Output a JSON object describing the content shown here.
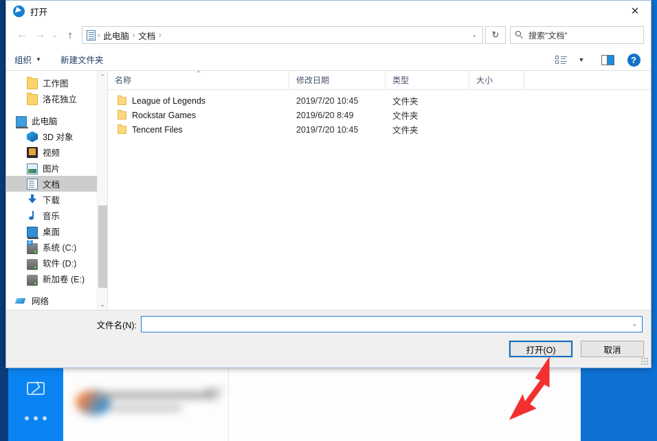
{
  "window": {
    "title": "打开",
    "title_icon": "cursor-circle-icon",
    "close_label": "✕"
  },
  "nav": {
    "back_icon": "←",
    "forward_icon": "→",
    "recent_icon": "⌄",
    "up_icon": "↑",
    "address_icon": "documents-icon",
    "breadcrumbs": [
      "此电脑",
      "文档"
    ],
    "separator": "›",
    "dropdown_caret": "⌄",
    "refresh_icon": "↻"
  },
  "search": {
    "placeholder": "搜索\"文档\"",
    "icon": "search-icon"
  },
  "command_bar": {
    "organize_label": "组织",
    "organize_caret": "▼",
    "new_folder_label": "新建文件夹",
    "view_icon": "list-view-icon",
    "view_caret": "▼",
    "preview_pane_icon": "preview-pane-icon",
    "help_icon": "?"
  },
  "sidebar": {
    "scroll_up": "⌃",
    "scroll_down": "⌄",
    "items": [
      {
        "label": "工作图",
        "icon": "folder-icon",
        "indent": 1,
        "selected": false
      },
      {
        "label": "洛花独立",
        "icon": "folder-icon",
        "indent": 1,
        "selected": false
      },
      {
        "label": "此电脑",
        "icon": "this-pc-icon",
        "indent": 0,
        "selected": false
      },
      {
        "label": "3D 对象",
        "icon": "3d-objects-icon",
        "indent": 1,
        "selected": false
      },
      {
        "label": "视频",
        "icon": "videos-icon",
        "indent": 1,
        "selected": false
      },
      {
        "label": "图片",
        "icon": "pictures-icon",
        "indent": 1,
        "selected": false
      },
      {
        "label": "文档",
        "icon": "documents-icon",
        "indent": 1,
        "selected": true
      },
      {
        "label": "下载",
        "icon": "downloads-icon",
        "indent": 1,
        "selected": false
      },
      {
        "label": "音乐",
        "icon": "music-icon",
        "indent": 1,
        "selected": false
      },
      {
        "label": "桌面",
        "icon": "desktop-icon",
        "indent": 1,
        "selected": false
      },
      {
        "label": "系统 (C:)",
        "icon": "system-drive-icon",
        "indent": 1,
        "selected": false
      },
      {
        "label": "软件 (D:)",
        "icon": "drive-icon",
        "indent": 1,
        "selected": false
      },
      {
        "label": "新加卷 (E:)",
        "icon": "drive-icon",
        "indent": 1,
        "selected": false
      },
      {
        "label": "网络",
        "icon": "network-icon",
        "indent": 0,
        "selected": false
      }
    ]
  },
  "file_list": {
    "columns": [
      "名称",
      "修改日期",
      "类型",
      "大小"
    ],
    "sort_caret": "⌃",
    "rows": [
      {
        "name": "League of Legends",
        "date": "2019/7/20 10:45",
        "type": "文件夹",
        "size": "",
        "icon": "folder-icon"
      },
      {
        "name": "Rockstar Games",
        "date": "2019/6/20 8:49",
        "type": "文件夹",
        "size": "",
        "icon": "folder-icon"
      },
      {
        "name": "Tencent Files",
        "date": "2019/7/20 10:45",
        "type": "文件夹",
        "size": "",
        "icon": "folder-icon"
      }
    ]
  },
  "footer": {
    "filename_label": "文件名(N):",
    "filename_value": "",
    "filename_placeholder": "",
    "filename_caret": "⌄",
    "open_button": "打开(O)",
    "cancel_button": "取消"
  },
  "annotation": {
    "arrow_color": "#f23030",
    "highlight_color": "#0d6fc9"
  },
  "desktop": {
    "background_color": "#0d72d4",
    "app_accent": "#0b84f3",
    "mail_icon": "mail-icon",
    "more_icon": "more-dots-icon"
  }
}
